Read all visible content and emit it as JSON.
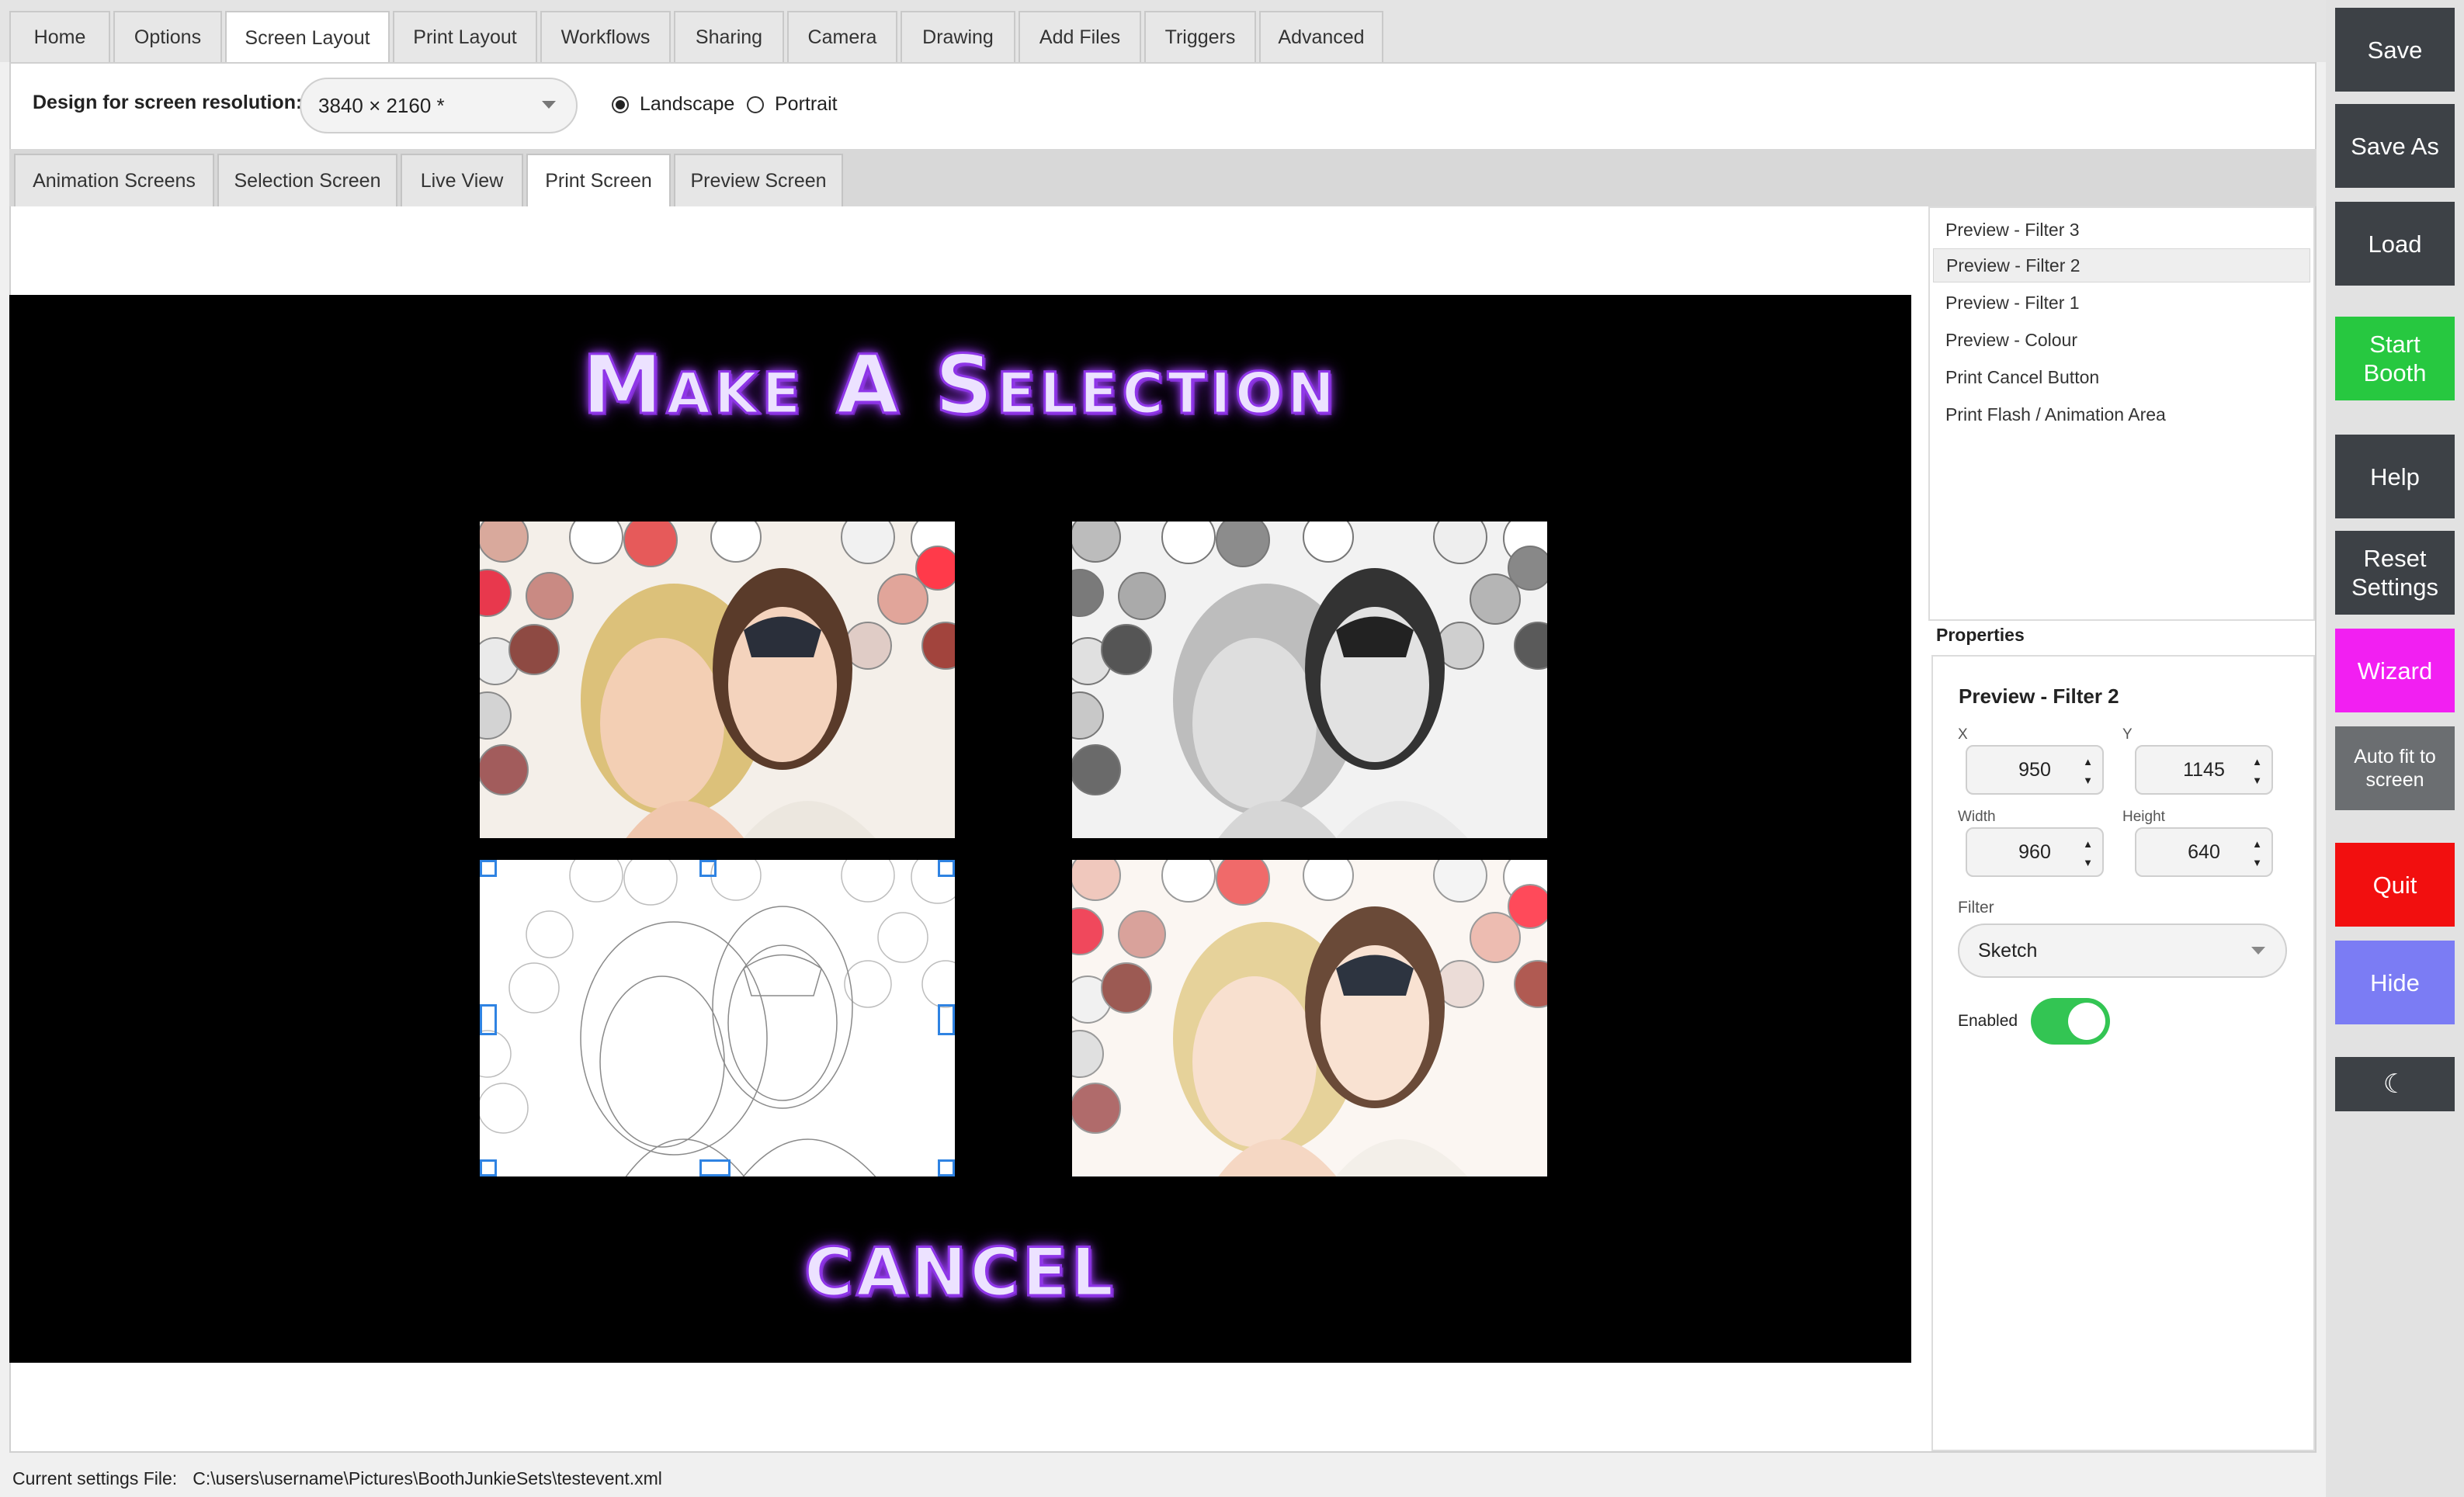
{
  "tabs": [
    "Home",
    "Options",
    "Screen Layout",
    "Print Layout",
    "Workflows",
    "Sharing",
    "Camera",
    "Drawing",
    "Add Files",
    "Triggers",
    "Advanced"
  ],
  "resolution": {
    "label": "Design for screen resolution:",
    "value": "3840 × 2160 *"
  },
  "orientation": {
    "landscape": "Landscape",
    "portrait": "Portrait",
    "selected": "Landscape"
  },
  "subtabs": [
    "Animation Screens",
    "Selection Screen",
    "Live View",
    "Print Screen",
    "Preview Screen"
  ],
  "canvas": {
    "headline": "Make A Selection",
    "cancel": "CANCEL"
  },
  "elements": [
    "Preview - Filter 3",
    "Preview - Filter 2",
    "Preview - Filter 1",
    "Preview - Colour",
    "Print Cancel Button",
    "Print Flash / Animation Area"
  ],
  "selected_element": "Preview - Filter 2",
  "properties": {
    "heading": "Properties",
    "title": "Preview - Filter 2",
    "x_label": "X",
    "x": "950",
    "y_label": "Y",
    "y": "1145",
    "width_label": "Width",
    "width": "960",
    "height_label": "Height",
    "height": "640",
    "filter_label": "Filter",
    "filter": "Sketch",
    "enabled_label": "Enabled",
    "enabled": true
  },
  "buttons": {
    "save": "Save",
    "save_as": "Save As",
    "load": "Load",
    "start_booth": "Start Booth",
    "help": "Help",
    "reset_settings": "Reset Settings",
    "wizard": "Wizard",
    "auto_fit": "Auto fit to screen",
    "quit": "Quit",
    "hide": "Hide",
    "theme": "☾"
  },
  "colors": {
    "start_booth": "#27c840",
    "wizard": "#f21ff2",
    "quit": "#f20f0f",
    "hide": "#7b7cf4",
    "dark_button": "#3d4146",
    "auto_fit": "#6b6e71"
  },
  "status": {
    "label": "Current settings File:",
    "path": "C:\\users\\username\\Pictures\\BoothJunkieSets\\testevent.xml"
  }
}
